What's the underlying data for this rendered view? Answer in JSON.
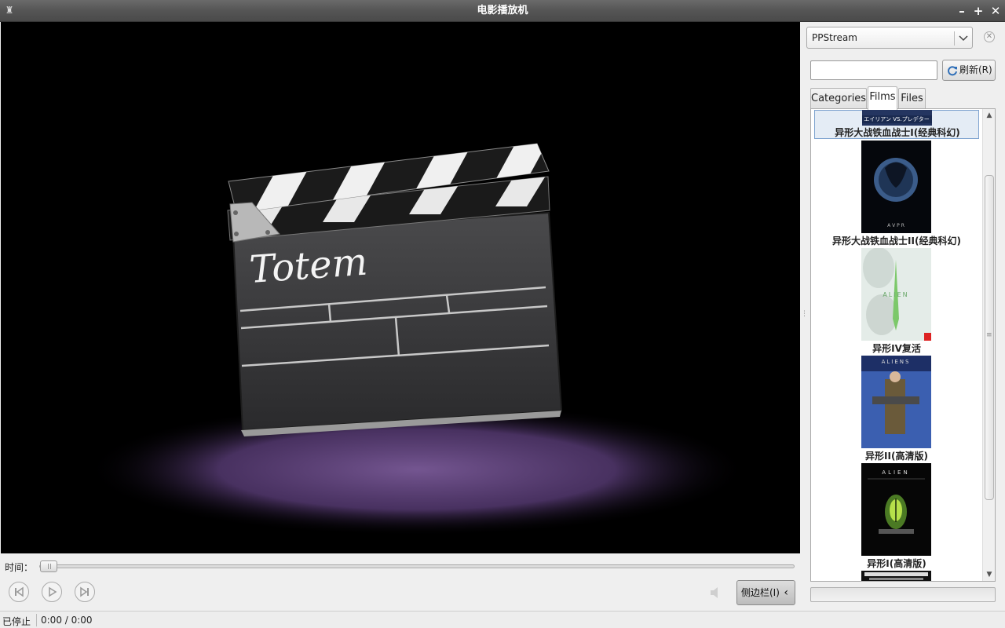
{
  "window": {
    "title": "电影播放机",
    "app_icon": "totem-icon",
    "minimize": "–",
    "maximize": "+",
    "close": "✕"
  },
  "video": {
    "logo_text": "Totem"
  },
  "seek": {
    "label": "时间：",
    "position": 0
  },
  "controls": {
    "prev_icon": "skip-previous-icon",
    "play_icon": "play-icon",
    "next_icon": "skip-next-icon",
    "volume_icon": "volume-muted-icon",
    "sidebar_button": "侧边栏(I)",
    "sidebar_chevron": "‹"
  },
  "status": {
    "state": "已停止",
    "time": "0:00 / 0:00"
  },
  "sidebar": {
    "source": "PPStream",
    "search_value": "",
    "refresh_label": "刷新(R)",
    "tabs": [
      {
        "label": "Categories"
      },
      {
        "label": "Films"
      },
      {
        "label": "Files"
      }
    ],
    "active_tab": "Films",
    "items": [
      {
        "label": "异形大战铁血战士I(经典科幻)",
        "poster_text": "エイリアン VS.プレデター",
        "selected": true
      },
      {
        "label": "异形大战铁血战士II(经典科幻)",
        "poster_text": "A V P R"
      },
      {
        "label": "异形IV复活",
        "poster_text": "ALIEN"
      },
      {
        "label": "异形II(高清版)",
        "poster_text": "ALIENS"
      },
      {
        "label": "异形I(高清版)",
        "poster_text": "ALIEN"
      }
    ]
  },
  "colors": {
    "titlebar": "#555555",
    "video_bg": "#000000",
    "spotlight": "#6a4a8a",
    "selection": "#e4ecf5"
  }
}
